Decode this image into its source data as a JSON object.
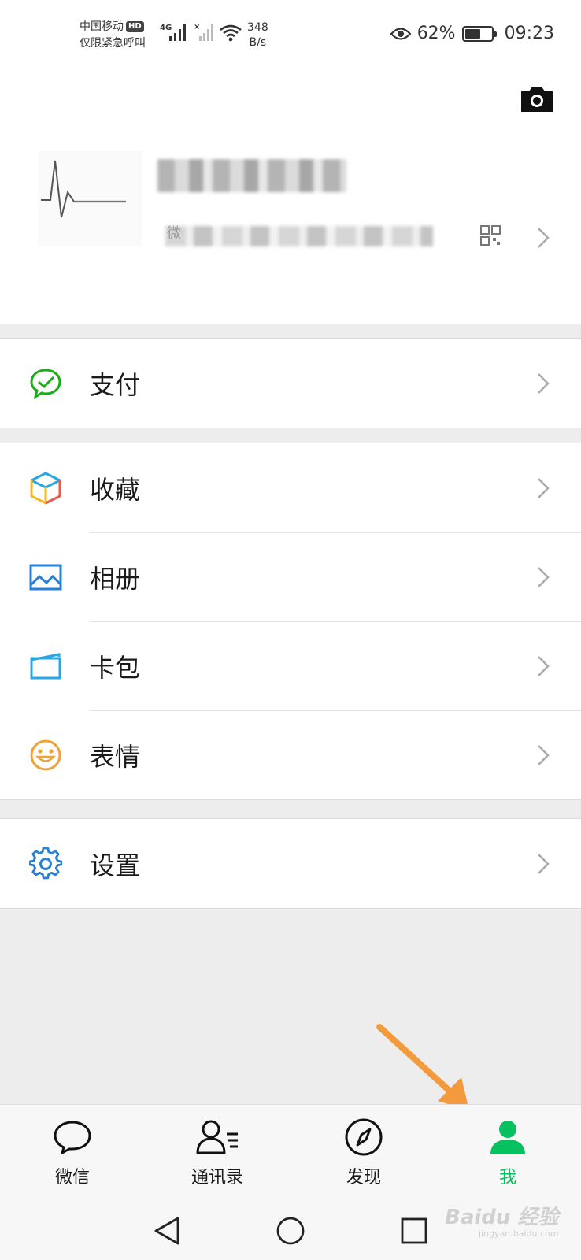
{
  "status": {
    "carrier": "中国移动",
    "hd": "HD",
    "carrier_sub": "仅限紧急呼叫",
    "net": "4G",
    "speed_value": "348",
    "speed_unit": "B/s",
    "battery_pct": "62%",
    "battery_level": 0.62,
    "time": "09:23"
  },
  "profile": {
    "name_prefix": "微"
  },
  "menu": {
    "pay": "支付",
    "favorites": "收藏",
    "album": "相册",
    "cards": "卡包",
    "stickers": "表情",
    "settings": "设置"
  },
  "tabs": [
    {
      "label": "微信",
      "icon": "chat-bubble-icon"
    },
    {
      "label": "通讯录",
      "icon": "contacts-icon"
    },
    {
      "label": "发现",
      "icon": "compass-icon"
    },
    {
      "label": "我",
      "icon": "person-icon"
    }
  ],
  "colors": {
    "accent": "#07c160",
    "pay_green": "#1aad19",
    "album_blue": "#2782d7",
    "sticker_orange": "#f0a236",
    "settings_blue": "#2782d7",
    "arrow_orange": "#f39a3c"
  },
  "watermark": {
    "brand": "Baidu 经验",
    "url": "jingyan.baidu.com"
  }
}
